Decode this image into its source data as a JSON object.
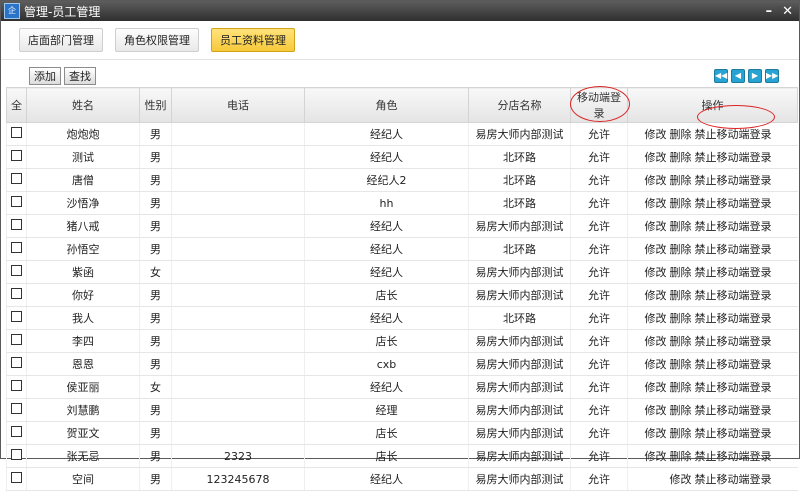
{
  "window": {
    "title": "管理-员工管理"
  },
  "tabs": [
    {
      "label": "店面部门管理",
      "active": false
    },
    {
      "label": "角色权限管理",
      "active": false
    },
    {
      "label": "员工资料管理",
      "active": true
    }
  ],
  "toolbar": {
    "add_label": "添加",
    "search_label": "查找"
  },
  "table": {
    "headers": [
      "全",
      "姓名",
      "性别",
      "电话",
      "角色",
      "分店名称",
      "移动端登录",
      "操作"
    ],
    "rows": [
      {
        "name": "炮炮炮",
        "gender": "男",
        "phone": "",
        "role": "经纪人",
        "store": "易房大师内部测试",
        "mobile": "允许",
        "ops": [
          "修改",
          "删除",
          "禁止移动端登录"
        ]
      },
      {
        "name": "测试",
        "gender": "男",
        "phone": "",
        "role": "经纪人",
        "store": "北环路",
        "mobile": "允许",
        "ops": [
          "修改",
          "删除",
          "禁止移动端登录"
        ]
      },
      {
        "name": "唐僧",
        "gender": "男",
        "phone": "",
        "role": "经纪人2",
        "store": "北环路",
        "mobile": "允许",
        "ops": [
          "修改",
          "删除",
          "禁止移动端登录"
        ]
      },
      {
        "name": "沙悟净",
        "gender": "男",
        "phone": "",
        "role": "hh",
        "store": "北环路",
        "mobile": "允许",
        "ops": [
          "修改",
          "删除",
          "禁止移动端登录"
        ]
      },
      {
        "name": "猪八戒",
        "gender": "男",
        "phone": "",
        "role": "经纪人",
        "store": "易房大师内部测试",
        "mobile": "允许",
        "ops": [
          "修改",
          "删除",
          "禁止移动端登录"
        ]
      },
      {
        "name": "孙悟空",
        "gender": "男",
        "phone": "",
        "role": "经纪人",
        "store": "北环路",
        "mobile": "允许",
        "ops": [
          "修改",
          "删除",
          "禁止移动端登录"
        ]
      },
      {
        "name": "紫函",
        "gender": "女",
        "phone": "",
        "role": "经纪人",
        "store": "易房大师内部测试",
        "mobile": "允许",
        "ops": [
          "修改",
          "删除",
          "禁止移动端登录"
        ]
      },
      {
        "name": "你好",
        "gender": "男",
        "phone": "",
        "role": "店长",
        "store": "易房大师内部测试",
        "mobile": "允许",
        "ops": [
          "修改",
          "删除",
          "禁止移动端登录"
        ]
      },
      {
        "name": "我人",
        "gender": "男",
        "phone": "",
        "role": "经纪人",
        "store": "北环路",
        "mobile": "允许",
        "ops": [
          "修改",
          "删除",
          "禁止移动端登录"
        ]
      },
      {
        "name": "李四",
        "gender": "男",
        "phone": "",
        "role": "店长",
        "store": "易房大师内部测试",
        "mobile": "允许",
        "ops": [
          "修改",
          "删除",
          "禁止移动端登录"
        ]
      },
      {
        "name": "恩恩",
        "gender": "男",
        "phone": "",
        "role": "cxb",
        "store": "易房大师内部测试",
        "mobile": "允许",
        "ops": [
          "修改",
          "删除",
          "禁止移动端登录"
        ]
      },
      {
        "name": "侯亚丽",
        "gender": "女",
        "phone": "",
        "role": "经纪人",
        "store": "易房大师内部测试",
        "mobile": "允许",
        "ops": [
          "修改",
          "删除",
          "禁止移动端登录"
        ]
      },
      {
        "name": "刘慧鹏",
        "gender": "男",
        "phone": "",
        "role": "经理",
        "store": "易房大师内部测试",
        "mobile": "允许",
        "ops": [
          "修改",
          "删除",
          "禁止移动端登录"
        ]
      },
      {
        "name": "贺亚文",
        "gender": "男",
        "phone": "",
        "role": "店长",
        "store": "易房大师内部测试",
        "mobile": "允许",
        "ops": [
          "修改",
          "删除",
          "禁止移动端登录"
        ]
      },
      {
        "name": "张无忌",
        "gender": "男",
        "phone": "2323",
        "role": "店长",
        "store": "易房大师内部测试",
        "mobile": "允许",
        "ops": [
          "修改",
          "删除",
          "禁止移动端登录"
        ]
      },
      {
        "name": "空间",
        "gender": "男",
        "phone": "123245678",
        "role": "经纪人",
        "store": "易房大师内部测试",
        "mobile": "允许",
        "ops": [
          "修改",
          "禁止移动端登录"
        ]
      }
    ]
  }
}
